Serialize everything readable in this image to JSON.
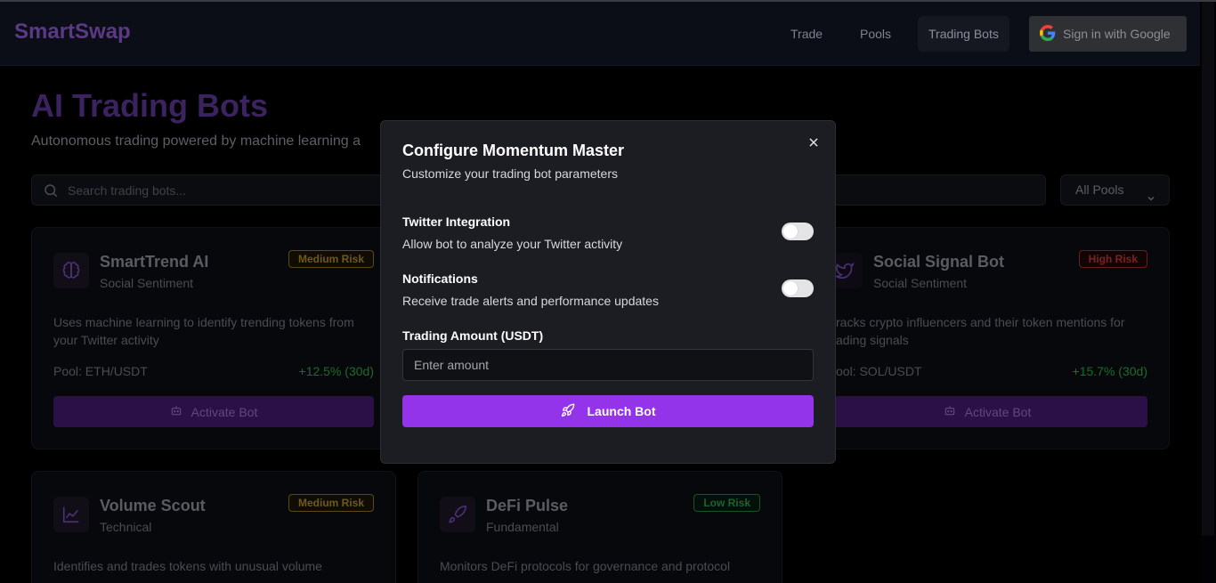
{
  "nav": {
    "brand": "SmartSwap",
    "links": [
      {
        "label": "Trade"
      },
      {
        "label": "Pools"
      },
      {
        "label": "Trading Bots"
      }
    ],
    "signin_label": "Sign in with Google"
  },
  "page": {
    "title": "AI Trading Bots",
    "subtitle": "Autonomous trading powered by machine learning a",
    "search_placeholder": "Search trading bots...",
    "pool_filter": "All Pools"
  },
  "bots": [
    {
      "name": "SmartTrend AI",
      "category": "Social Sentiment",
      "risk": "Medium Risk",
      "description": "Uses machine learning to identify trending tokens from your Twitter activity",
      "pool": "Pool: ETH/USDT",
      "performance": "+12.5% (30d)",
      "action": "Activate Bot",
      "icon": "brain-icon"
    },
    {
      "name": "Social Signal Bot",
      "category": "Social Sentiment",
      "risk": "High Risk",
      "description": "racks crypto influencers and their token mentions for ading signals",
      "pool": "ool: SOL/USDT",
      "performance": "+15.7% (30d)",
      "action": "Activate Bot",
      "icon": "twitter-icon"
    },
    {
      "name": "Volume Scout",
      "category": "Technical",
      "risk": "Medium Risk",
      "description": "Identifies and trades tokens with unusual volume",
      "icon": "chart-icon"
    },
    {
      "name": "DeFi Pulse",
      "category": "Fundamental",
      "risk": "Low Risk",
      "description": "Monitors DeFi protocols for governance and protocol",
      "icon": "rocket-icon"
    }
  ],
  "modal": {
    "title": "Configure Momentum Master",
    "subtitle": "Customize your trading bot parameters",
    "twitter_label": "Twitter Integration",
    "twitter_desc": "Allow bot to analyze your Twitter activity",
    "twitter_enabled": false,
    "notifications_label": "Notifications",
    "notifications_desc": "Receive trade alerts and performance updates",
    "notifications_enabled": false,
    "amount_label": "Trading Amount (USDT)",
    "amount_placeholder": "Enter amount",
    "launch_label": "Launch Bot"
  },
  "colors": {
    "accent": "#9333ea",
    "modal_bg": "#1c1d22"
  }
}
